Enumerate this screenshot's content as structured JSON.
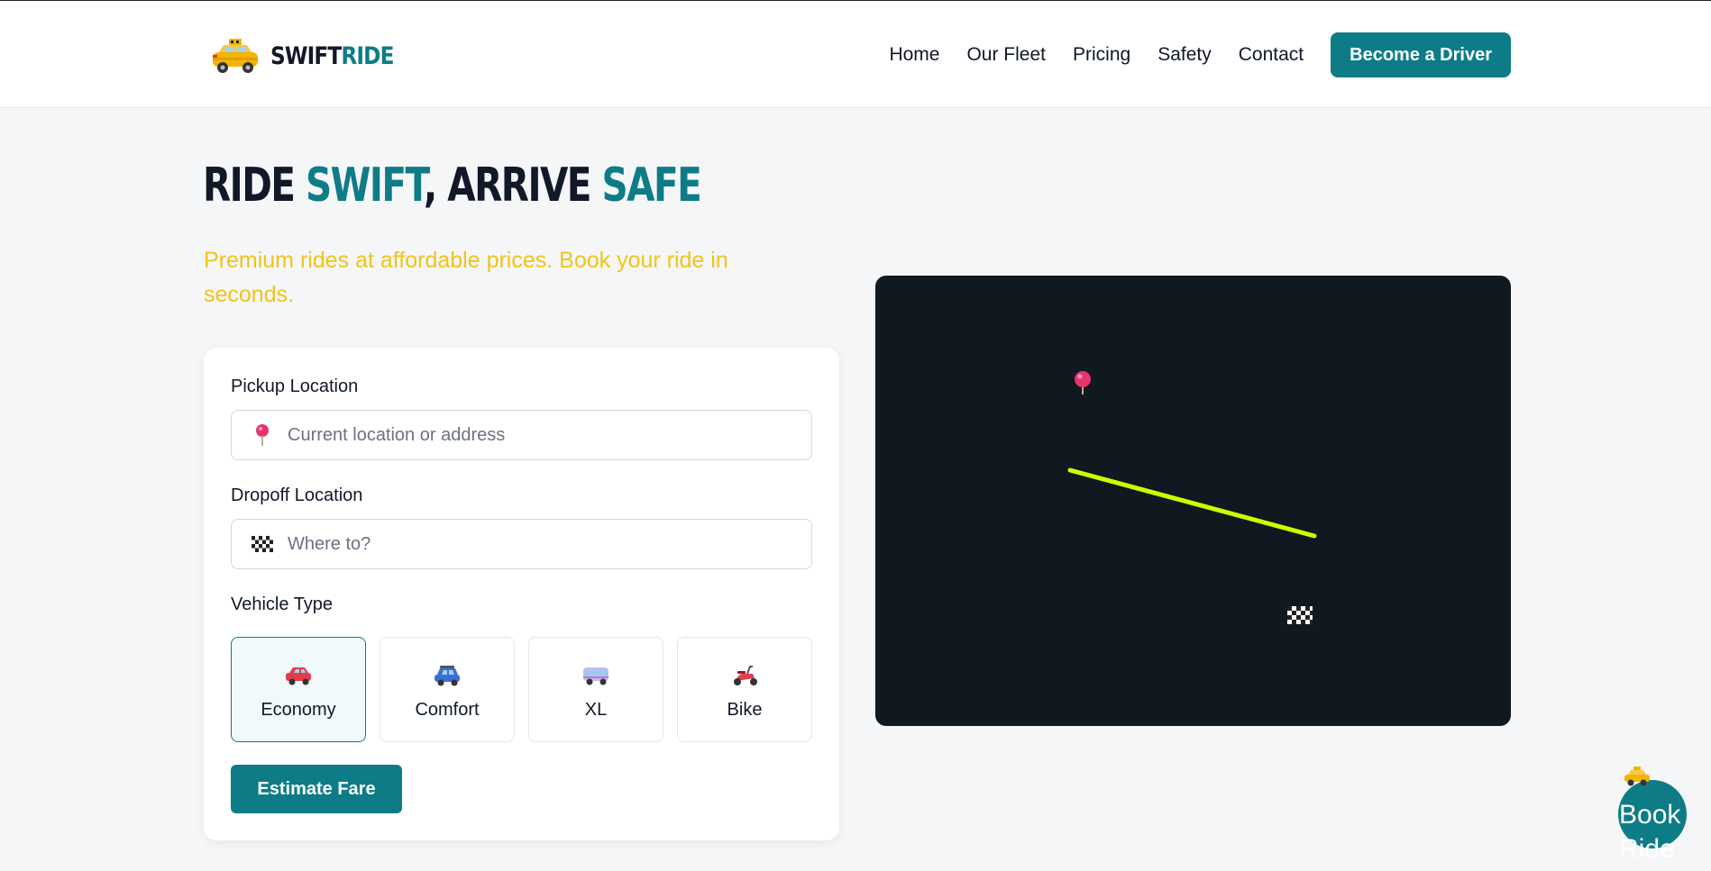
{
  "brand": {
    "name_part1": "SWIFT",
    "name_part2": "RIDE",
    "logo_icon": "taxi-icon"
  },
  "nav": {
    "items": [
      "Home",
      "Our Fleet",
      "Pricing",
      "Safety",
      "Contact"
    ],
    "cta": "Become a Driver"
  },
  "hero": {
    "title_part1": "RIDE ",
    "title_accent1": "SWIFT",
    "title_part2": ", ARRIVE ",
    "title_accent2": "SAFE",
    "subtitle": "Premium rides at affordable prices. Book your ride in seconds."
  },
  "booking": {
    "pickup_label": "Pickup Location",
    "pickup_placeholder": "Current location or address",
    "pickup_value": "",
    "pickup_icon": "pin-icon",
    "dropoff_label": "Dropoff Location",
    "dropoff_placeholder": "Where to?",
    "dropoff_value": "",
    "dropoff_icon": "checkered-flag-icon",
    "vehicle_label": "Vehicle Type",
    "vehicles": [
      {
        "name": "Economy",
        "icon": "red-car-icon",
        "selected": true
      },
      {
        "name": "Comfort",
        "icon": "blue-car-icon",
        "selected": false
      },
      {
        "name": "XL",
        "icon": "minibus-icon",
        "selected": false
      },
      {
        "name": "Bike",
        "icon": "scooter-icon",
        "selected": false
      }
    ],
    "estimate_button": "Estimate Fare"
  },
  "map": {
    "background": "#101820",
    "route_color": "#ccff00",
    "pin_color": "#e8336d"
  },
  "fab": {
    "label": "Book Ride",
    "icon": "taxi-icon"
  },
  "colors": {
    "accent": "#0e7c86",
    "subtitle": "#f0c419",
    "text": "#111827"
  }
}
